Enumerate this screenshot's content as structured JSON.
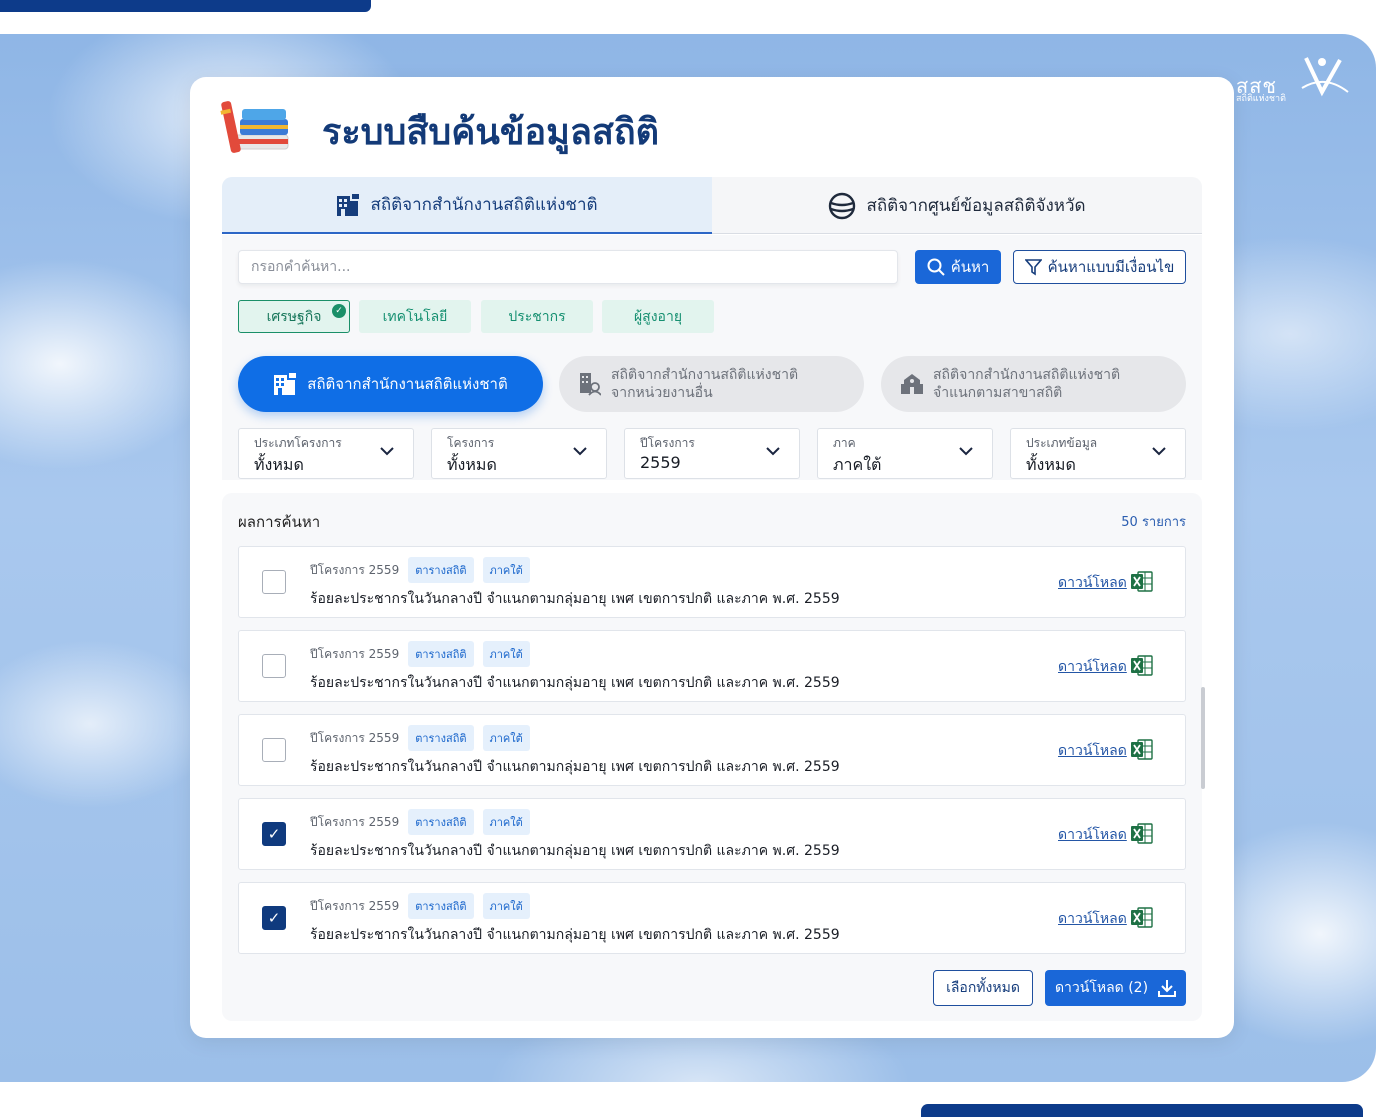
{
  "brand": {
    "name": "สสช",
    "subtitle": "สถิติแห่งชาติ"
  },
  "page": {
    "title": "ระบบสืบค้นข้อมูลสถิติ"
  },
  "tabs": [
    {
      "label": "สถิติจากสำนักงานสถิติแห่งชาติ",
      "icon": "building-icon",
      "active": true
    },
    {
      "label": "สถิติจากศูนย์ข้อมูลสถิติจังหวัด",
      "icon": "globe-icon",
      "active": false
    }
  ],
  "search": {
    "placeholder": "กรอกคำค้นหา...",
    "value": "",
    "button": "ค้นหา",
    "advanced_button": "ค้นหาแบบมีเงื่อนไข"
  },
  "categories": [
    {
      "label": "เศรษฐกิจ",
      "selected": true
    },
    {
      "label": "เทคโนโลยี",
      "selected": false
    },
    {
      "label": "ประชากร",
      "selected": false
    },
    {
      "label": "ผู้สูงอายุ",
      "selected": false
    }
  ],
  "sources": [
    {
      "line1": "สถิติจากสำนักงานสถิติแห่งชาติ",
      "line2": "",
      "active": true
    },
    {
      "line1": "สถิติจากสำนักงานสถิติแห่งชาติ",
      "line2": "จากหน่วยงานอื่น",
      "active": false
    },
    {
      "line1": "สถิติจากสำนักงานสถิติแห่งชาติ",
      "line2": "จำแนกตามสาขาสถิติ",
      "active": false
    }
  ],
  "filters": [
    {
      "label": "ประเภทโครงการ",
      "value": "ทั้งหมด"
    },
    {
      "label": "โครงการ",
      "value": "ทั้งหมด"
    },
    {
      "label": "ปีโครงการ",
      "value": "2559"
    },
    {
      "label": "ภาค",
      "value": "ภาคใต้"
    },
    {
      "label": "ประเภทข้อมูล",
      "value": "ทั้งหมด"
    }
  ],
  "results": {
    "title": "ผลการค้นหา",
    "count": "50 รายการ",
    "items": [
      {
        "year": "ปีโครงการ 2559",
        "tag1": "ตารางสถิติ",
        "tag2": "ภาคใต้",
        "title": "ร้อยละประชากรในวันกลางปี จำแนกตามกลุ่มอายุ เพศ เขตการปกติ และภาค พ.ศ. 2559",
        "download": "ดาวน์โหลด",
        "checked": false
      },
      {
        "year": "ปีโครงการ 2559",
        "tag1": "ตารางสถิติ",
        "tag2": "ภาคใต้",
        "title": "ร้อยละประชากรในวันกลางปี จำแนกตามกลุ่มอายุ เพศ เขตการปกติ และภาค พ.ศ. 2559",
        "download": "ดาวน์โหลด",
        "checked": false
      },
      {
        "year": "ปีโครงการ 2559",
        "tag1": "ตารางสถิติ",
        "tag2": "ภาคใต้",
        "title": "ร้อยละประชากรในวันกลางปี จำแนกตามกลุ่มอายุ เพศ เขตการปกติ และภาค พ.ศ. 2559",
        "download": "ดาวน์โหลด",
        "checked": false
      },
      {
        "year": "ปีโครงการ 2559",
        "tag1": "ตารางสถิติ",
        "tag2": "ภาคใต้",
        "title": "ร้อยละประชากรในวันกลางปี จำแนกตามกลุ่มอายุ เพศ เขตการปกติ และภาค พ.ศ. 2559",
        "download": "ดาวน์โหลด",
        "checked": true
      },
      {
        "year": "ปีโครงการ 2559",
        "tag1": "ตารางสถิติ",
        "tag2": "ภาคใต้",
        "title": "ร้อยละประชากรในวันกลางปี จำแนกตามกลุ่มอายุ เพศ เขตการปกติ และภาค พ.ศ. 2559",
        "download": "ดาวน์โหลด",
        "checked": true
      }
    ],
    "select_all": "เลือกทั้งหมด",
    "download_selected": "ดาวน์โหลด (2)"
  },
  "colors": {
    "primary": "#1a67d8",
    "navy": "#133a78",
    "green": "#1a8f68"
  }
}
